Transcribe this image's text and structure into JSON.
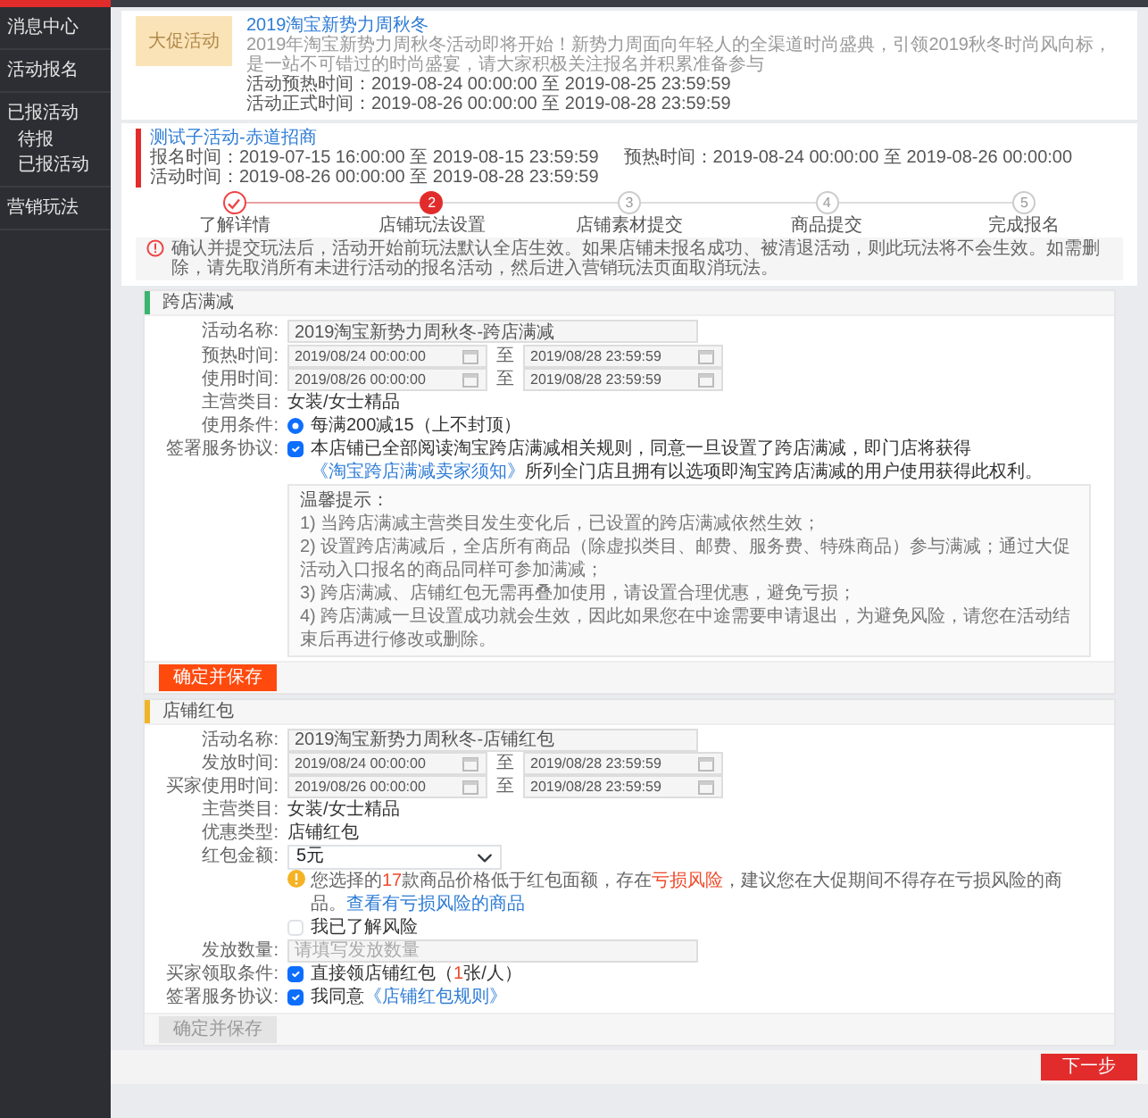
{
  "sidebar": {
    "items": [
      {
        "label": "消息中心"
      },
      {
        "label": "活动报名"
      },
      {
        "label": "已报活动",
        "children": [
          {
            "label": "待报"
          },
          {
            "label": "已报活动"
          }
        ]
      },
      {
        "label": "营销玩法"
      }
    ]
  },
  "campaign": {
    "badge": "大促活动",
    "title": "2019淘宝新势力周秋冬",
    "description": "2019年淘宝新势力周秋冬活动即将开始！新势力周面向年轻人的全渠道时尚盛典，引领2019秋冬时尚风向标，是一站不可错过的时尚盛宴，请大家积极关注报名并积累准备参与",
    "times": [
      "活动预热时间：2019-08-24 00:00:00 至 2019-08-25 23:59:59",
      "活动正式时间：2019-08-26 00:00:00 至 2019-08-28 23:59:59"
    ]
  },
  "activity": {
    "title": "测试子活动-赤道招商",
    "times": [
      "报名时间：2019-07-15 16:00:00 至 2019-08-15 23:59:59",
      "预热时间：2019-08-24 00:00:00 至 2019-08-26 00:00:00",
      "活动时间：2019-08-26 00:00:00 至 2019-08-28 23:59:59"
    ]
  },
  "steps": [
    {
      "label": "了解详情",
      "kind": "done"
    },
    {
      "number": "2",
      "label": "店铺玩法设置",
      "kind": "current"
    },
    {
      "number": "3",
      "label": "店铺素材提交",
      "kind": "pending"
    },
    {
      "number": "4",
      "label": "商品提交",
      "kind": "pending"
    },
    {
      "number": "5",
      "label": "完成报名",
      "kind": "pending"
    }
  ],
  "notice": "确认并提交玩法后，活动开始前玩法默认全店生效。如果店铺未报名成功、被清退活动，则此玩法将不会生效。如需删除，请先取消所有未进行活动的报名活动，然后进入营销玩法页面取消玩法。",
  "sections": [
    {
      "title": "跨店满减",
      "color": "#3cb371",
      "fields": [
        {
          "kind": "text-input",
          "label": "活动名称:",
          "value": "2019淘宝新势力周秋冬-跨店满减"
        },
        {
          "kind": "date-range",
          "label": "预热时间:",
          "from": "2019/08/24 00:00:00",
          "separator": "至",
          "to": "2019/08/28 23:59:59"
        },
        {
          "kind": "date-range",
          "label": "使用时间:",
          "from": "2019/08/26 00:00:00",
          "separator": "至",
          "to": "2019/08/28 23:59:59"
        },
        {
          "kind": "static",
          "label": "主营类目:",
          "value": "女装/女士精品"
        },
        {
          "kind": "radio",
          "label": "使用条件:",
          "option": "每满200减15（上不封顶）",
          "selected": true
        },
        {
          "kind": "checkbox",
          "label": "签署服务协议:",
          "checked": true,
          "parts": [
            {
              "kind": "plain",
              "text": "本店铺已全部阅读淘宝跨店满减相关规则，同意一旦设置了跨店满减，即门店将获得"
            },
            {
              "kind": "link",
              "text": "《淘宝跨店满减卖家须知》"
            },
            {
              "kind": "plain",
              "text": "所列全门店且拥有以选项即淘宝跨店满减的用户使用获得此权利。"
            }
          ]
        },
        {
          "kind": "tips",
          "title": "温馨提示：",
          "lines": [
            "1) 当跨店满减主营类目发生变化后，已设置的跨店满减依然生效；",
            "2) 设置跨店满减后，全店所有商品（除虚拟类目、邮费、服务费、特殊商品）参与满减；通过大促活动入口报名的商品同样可参加满减；",
            "3) 跨店满减、店铺红包无需再叠加使用，请设置合理优惠，避免亏损；",
            "4) 跨店满减一旦设置成功就会生效，因此如果您在中途需要申请退出，为避免风险，请您在活动结束后再进行修改或删除。"
          ]
        }
      ],
      "save_button": {
        "label": "确定并保存",
        "disabled": false
      }
    },
    {
      "title": "店铺红包",
      "color": "#f0b429",
      "fields": [
        {
          "kind": "text-input",
          "label": "活动名称:",
          "value": "2019淘宝新势力周秋冬-店铺红包"
        },
        {
          "kind": "date-range",
          "label": "发放时间:",
          "from": "2019/08/24 00:00:00",
          "separator": "至",
          "to": "2019/08/28 23:59:59"
        },
        {
          "kind": "date-range",
          "label": "买家使用时间:",
          "from": "2019/08/26 00:00:00",
          "separator": "至",
          "to": "2019/08/28 23:59:59"
        },
        {
          "kind": "static",
          "label": "主营类目:",
          "value": "女装/女士精品"
        },
        {
          "kind": "static",
          "label": "优惠类型:",
          "value": "店铺红包"
        },
        {
          "kind": "select",
          "label": "红包金额:",
          "value": "5元"
        },
        {
          "kind": "warning",
          "parts": [
            {
              "kind": "plain",
              "text": "您选择的"
            },
            {
              "kind": "alert",
              "text": "17"
            },
            {
              "kind": "plain",
              "text": "款商品价格低于红包面额，存在"
            },
            {
              "kind": "alert",
              "text": "亏损风险"
            },
            {
              "kind": "plain",
              "text": "，建议您在大促期间不得存在亏损风险的商品。"
            },
            {
              "kind": "link",
              "text": "查看有亏损风险的商品"
            }
          ]
        },
        {
          "kind": "checkbox",
          "checked": false,
          "parts": [
            {
              "kind": "plain",
              "text": "我已了解风险"
            }
          ]
        },
        {
          "kind": "text-input",
          "label": "发放数量:",
          "placeholder": "请填写发放数量"
        },
        {
          "kind": "checkbox",
          "label": "买家领取条件:",
          "checked": true,
          "parts": [
            {
              "kind": "plain",
              "text": "直接领店铺红包（"
            },
            {
              "kind": "alert",
              "text": "1"
            },
            {
              "kind": "plain",
              "text": "张/人）"
            }
          ]
        },
        {
          "kind": "checkbox",
          "label": "签署服务协议:",
          "checked": true,
          "parts": [
            {
              "kind": "plain",
              "text": "我同意"
            },
            {
              "kind": "link",
              "text": "《店铺红包规则》"
            }
          ]
        }
      ],
      "save_button": {
        "label": "确定并保存",
        "disabled": true
      }
    }
  ],
  "next_button": {
    "label": "下一步"
  }
}
